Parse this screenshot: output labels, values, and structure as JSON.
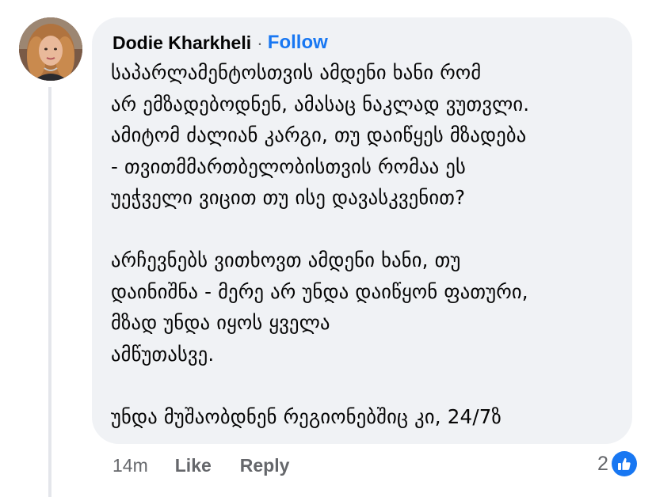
{
  "comment": {
    "author": "Dodie Kharkheli",
    "separator": "·",
    "follow_label": "Follow",
    "lines": [
      "საპარლამენტოსთვის ამდენი ხანი რომ",
      "არ ემზადებოდნენ, ამასაც ნაკლად ვუთვლი.",
      "ამიტომ ძალიან კარგი, თუ დაიწყეს მზადება",
      "- თვითმმართბელობისთვის რომაა ეს",
      "უეჭველი ვიცით თუ ისე დავასკვენით?",
      "",
      "არჩევნებს ვითხოვთ ამდენი ხანი, თუ",
      "დაინიშნა - მერე არ უნდა დაიწყონ ფათური,",
      "მზად უნდა იყოს ყველა",
      "ამწუთასვე.",
      "",
      "უნდა მუშაობდნენ რეგიონებშიც კი, 24/7ზ"
    ],
    "time": "14m",
    "like_label": "Like",
    "reply_label": "Reply",
    "reaction_count": "2",
    "reaction_icon": "like-thumb-icon",
    "colors": {
      "bubble": "#f0f2f5",
      "accent": "#1877f2",
      "meta": "#65676b",
      "text": "#050505"
    }
  }
}
